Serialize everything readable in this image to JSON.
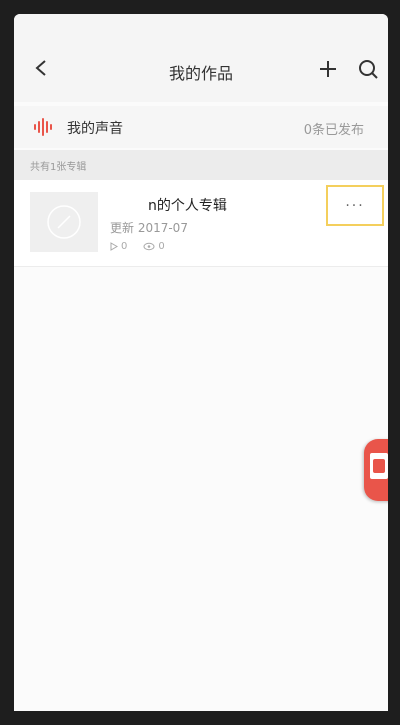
{
  "header": {
    "title": "我的作品",
    "icons": {
      "back": "back-arrow-icon",
      "add": "plus-icon",
      "search": "search-icon"
    }
  },
  "voice_row": {
    "label": "我的声音",
    "count_text": "0条已发布",
    "icon": "sound-wave-icon",
    "accent_color": "#e9554a"
  },
  "section": {
    "label": "共有1张专辑"
  },
  "album": {
    "title": "n的个人专辑",
    "updated": "更新 2017-07",
    "plays": "0",
    "likes": "0",
    "more_label": "···"
  },
  "float_badge": {
    "icon": "gift-icon",
    "color": "#e9554a"
  }
}
